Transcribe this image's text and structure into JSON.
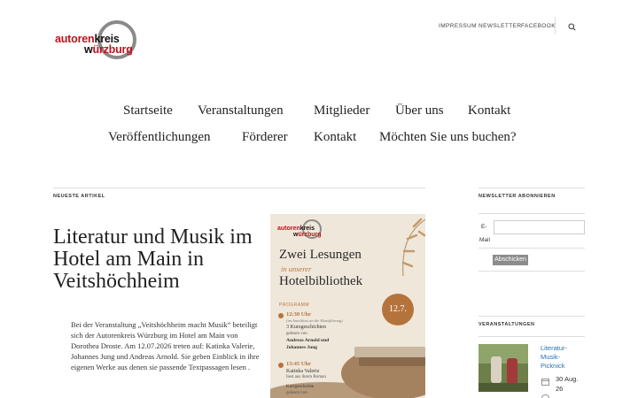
{
  "logo": {
    "line1_red": "autoren",
    "line1_black": "kreis",
    "line2_black": "w",
    "line2_red": "ürzburg"
  },
  "top_nav": [
    "IMPRESSUM",
    "NEWSLETTER",
    "FACEBOOK"
  ],
  "main_menu": {
    "row1": [
      "Startseite",
      "Veranstaltungen",
      "Mitglieder",
      "Über uns",
      "Kontakt"
    ],
    "row2": [
      "Veröffentlichungen",
      "Förderer",
      "Kontakt",
      "Möchten Sie uns buchen?"
    ]
  },
  "latest": {
    "label": "NEUESTE ARTIKEL",
    "title": "Literatur und Musik im Hotel am Main in Veitshöchheim",
    "excerpt": "Bei der Veranstaltung „Veitshöchheim macht Musik“ beteiligt sich der Autorenkreis Würzburg im Hotel am Main von Dorothea Droste. Am 12.07.2026 treten auf: Katinka Valerie, Johannes Jung und Andreas Arnold. Sie geben Einblick in ihre eigenen Werke aus denen sie passende Textpassagen lesen ."
  },
  "poster": {
    "heading1": "Zwei Lesungen",
    "heading2": "in unserer",
    "heading3": "Hotelbibliothek",
    "date": "12.7.",
    "program_label": "PROGRAMM",
    "time1": "12:30 Uhr",
    "note1": "(im Anschluss an die Hausführung)",
    "item1a": "3 Kurzgeschichten",
    "item1b": "gelesen von",
    "item1c": "Andreas Arnold und",
    "item1d": "Johannes Jung",
    "time2": "13:45 Uhr",
    "item2a": "Katinka Valerie",
    "item2b": "liest aus ihrem Roman",
    "item2c": "Kurzgeschichte",
    "item2d": "gelesen von"
  },
  "newsletter": {
    "label": "NEWSLETTER ABONNIEREN",
    "email_label_1": "E-",
    "email_label_2": "Mail",
    "button": "Abschicken"
  },
  "events": {
    "label": "VERANSTALTUNGEN",
    "item_title": [
      "Literatur-",
      "Musik-",
      "Picknick"
    ],
    "date_1": "30 Aug.",
    "date_2": "26"
  }
}
